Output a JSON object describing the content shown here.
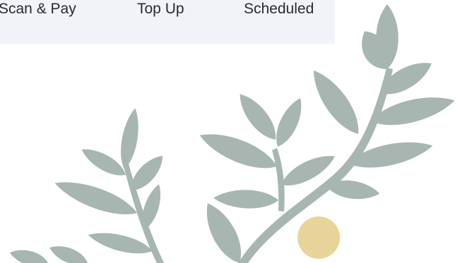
{
  "quick_actions": {
    "items": [
      {
        "label": "Scan & Pay"
      },
      {
        "label": "Top Up"
      },
      {
        "label": "Scheduled"
      }
    ]
  },
  "illustration": {
    "icon": "leafy-branch-illustration",
    "leaf_color": "#a7b6b0",
    "berry_color": "#e8d499"
  }
}
